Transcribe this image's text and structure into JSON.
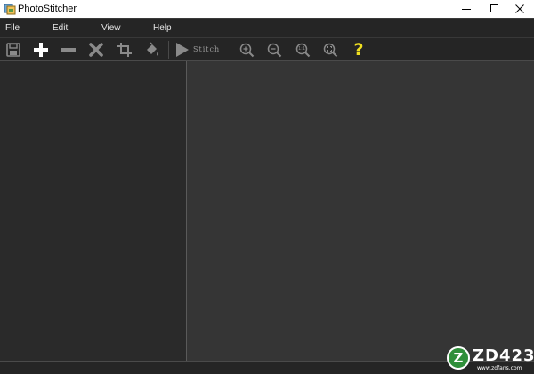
{
  "window": {
    "title": "PhotoStitcher",
    "controls": [
      "minimize-icon",
      "maximize-icon",
      "close-icon"
    ]
  },
  "menu": {
    "items": [
      "File",
      "Edit",
      "View",
      "Help"
    ]
  },
  "toolbar": {
    "buttons": [
      {
        "name": "save",
        "icon": "floppy-disk-icon"
      },
      {
        "name": "add",
        "icon": "plus-icon"
      },
      {
        "name": "remove",
        "icon": "minus-icon"
      },
      {
        "name": "delete",
        "icon": "x-icon"
      },
      {
        "name": "crop",
        "icon": "crop-icon"
      },
      {
        "name": "fill",
        "icon": "paint-bucket-icon"
      }
    ],
    "stitch_label": "Stitch",
    "zoom_buttons": [
      {
        "name": "zoom-in",
        "icon": "zoom-in-icon"
      },
      {
        "name": "zoom-out",
        "icon": "zoom-out-icon"
      },
      {
        "name": "zoom-actual",
        "icon": "zoom-1to1-icon",
        "label": "1:1"
      },
      {
        "name": "zoom-fit",
        "icon": "zoom-fit-icon"
      }
    ],
    "help_label": "?"
  },
  "colors": {
    "menubar_bg": "#252525",
    "panel_bg": "#2a2a2a",
    "canvas_bg": "#353535",
    "help_accent": "#f0e020",
    "watermark_green": "#2f8f3a"
  },
  "watermark": {
    "badge_letter": "Z",
    "brand": "ZD423",
    "site": "www.zdfans.com"
  }
}
